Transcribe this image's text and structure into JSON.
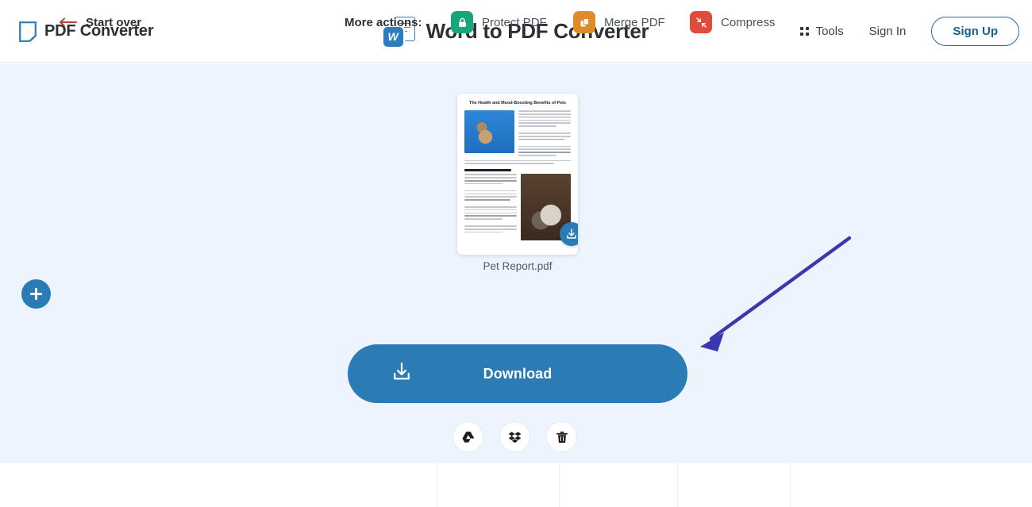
{
  "header": {
    "brand": "PDF Converter",
    "page_title": "Word to PDF Converter",
    "tools_label": "Tools",
    "signin_label": "Sign In",
    "signup_label": "Sign Up"
  },
  "main": {
    "add_file_label": "+",
    "file": {
      "name": "Pet Report.pdf",
      "doc_title": "The Health and Mood-Boosting Benefits of Pets"
    },
    "download_label": "Download",
    "cloud_buttons": [
      {
        "name": "google-drive",
        "label": "Google Drive"
      },
      {
        "name": "dropbox",
        "label": "Dropbox"
      },
      {
        "name": "delete",
        "label": "Delete"
      }
    ]
  },
  "footer": {
    "start_over_label": "Start over",
    "more_actions_label": "More actions:",
    "actions": [
      {
        "label": "Protect PDF",
        "color": "#17a579",
        "icon": "lock-icon"
      },
      {
        "label": "Merge PDF",
        "color": "#e08b2a",
        "icon": "merge-icon"
      },
      {
        "label": "Compress",
        "color": "#e14b3c",
        "icon": "compress-icon"
      }
    ]
  },
  "colors": {
    "accent_blue": "#2b7cb5",
    "body_background": "#edf4fe",
    "annotation_arrow": "#3a38b0",
    "signup_border": "#1f6ca8",
    "start_over_arrow": "#b7443f"
  }
}
